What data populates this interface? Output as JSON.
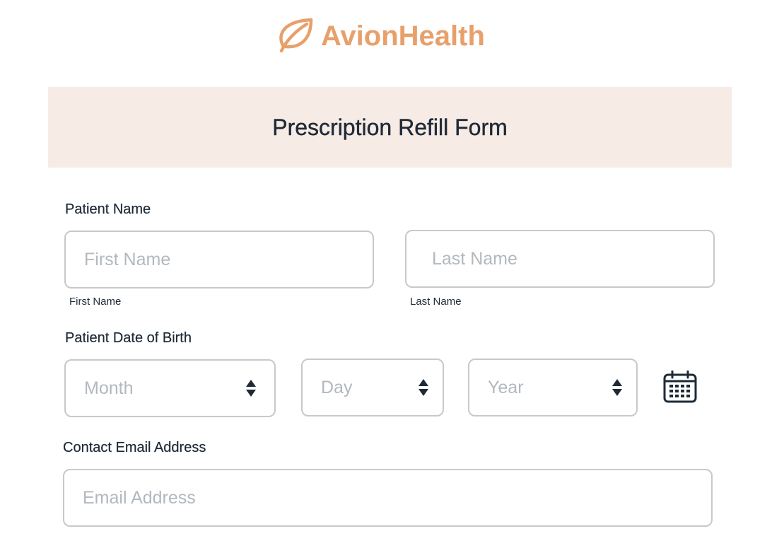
{
  "brand": {
    "name": "AvionHealth",
    "color": "#e8a06b",
    "logo_icon": "leaf-icon"
  },
  "banner": {
    "title": "Prescription Refill Form",
    "background": "#f7ebe6"
  },
  "patient_name": {
    "label": "Patient Name",
    "first": {
      "placeholder": "First Name",
      "value": "",
      "sublabel": "First Name"
    },
    "last": {
      "placeholder": "Last Name",
      "value": "",
      "sublabel": "Last Name"
    }
  },
  "dob": {
    "label": "Patient Date of Birth",
    "month": {
      "selected": "Month"
    },
    "day": {
      "selected": "Day"
    },
    "year": {
      "selected": "Year"
    },
    "calendar_icon": "calendar-icon"
  },
  "email": {
    "label": "Contact Email Address",
    "placeholder": "Email Address",
    "value": ""
  }
}
